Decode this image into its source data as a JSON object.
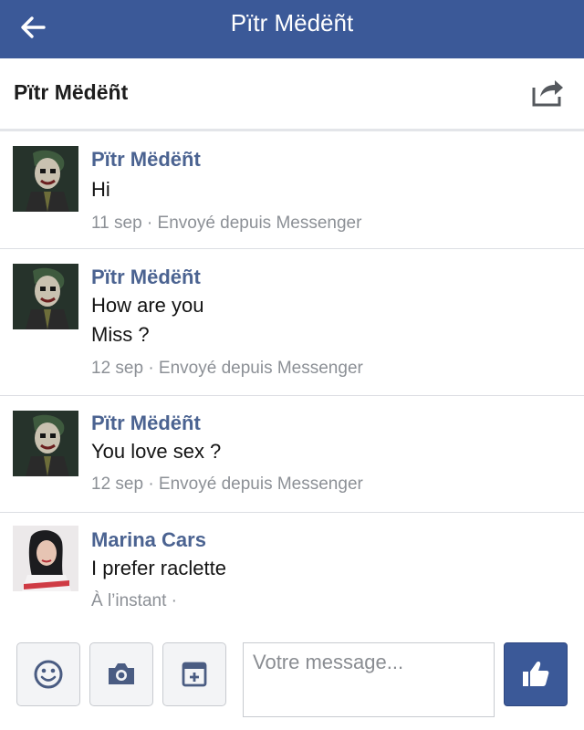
{
  "topbar": {
    "title": "Pïtr Mëdëñt",
    "back_icon": "arrow-left-icon"
  },
  "conversation": {
    "name": "Pïtr Mëdëñt",
    "share_icon": "share-icon"
  },
  "messages": [
    {
      "sender": "Pïtr Mëdëñt",
      "lines": [
        "Hi"
      ],
      "meta": "11 sep · Envoyé depuis Messenger"
    },
    {
      "sender": "Pïtr Mëdëñt",
      "lines": [
        "How are you",
        "Miss ?"
      ],
      "meta": "12 sep · Envoyé depuis Messenger"
    },
    {
      "sender": "Pïtr Mëdëñt",
      "lines": [
        "You love sex ?"
      ],
      "meta": "12 sep · Envoyé depuis Messenger"
    },
    {
      "sender": "Marina Cars",
      "lines": [
        "I prefer raclette"
      ],
      "meta": "À l’instant ·"
    }
  ],
  "composer": {
    "placeholder": "Votre message...",
    "tools": [
      "smiley-icon",
      "camera-icon",
      "sticker-icon"
    ],
    "send_icon": "thumbs-up-icon"
  },
  "colors": {
    "brand": "#3b5998",
    "sender": "#4b6391",
    "meta": "#8c9096"
  }
}
